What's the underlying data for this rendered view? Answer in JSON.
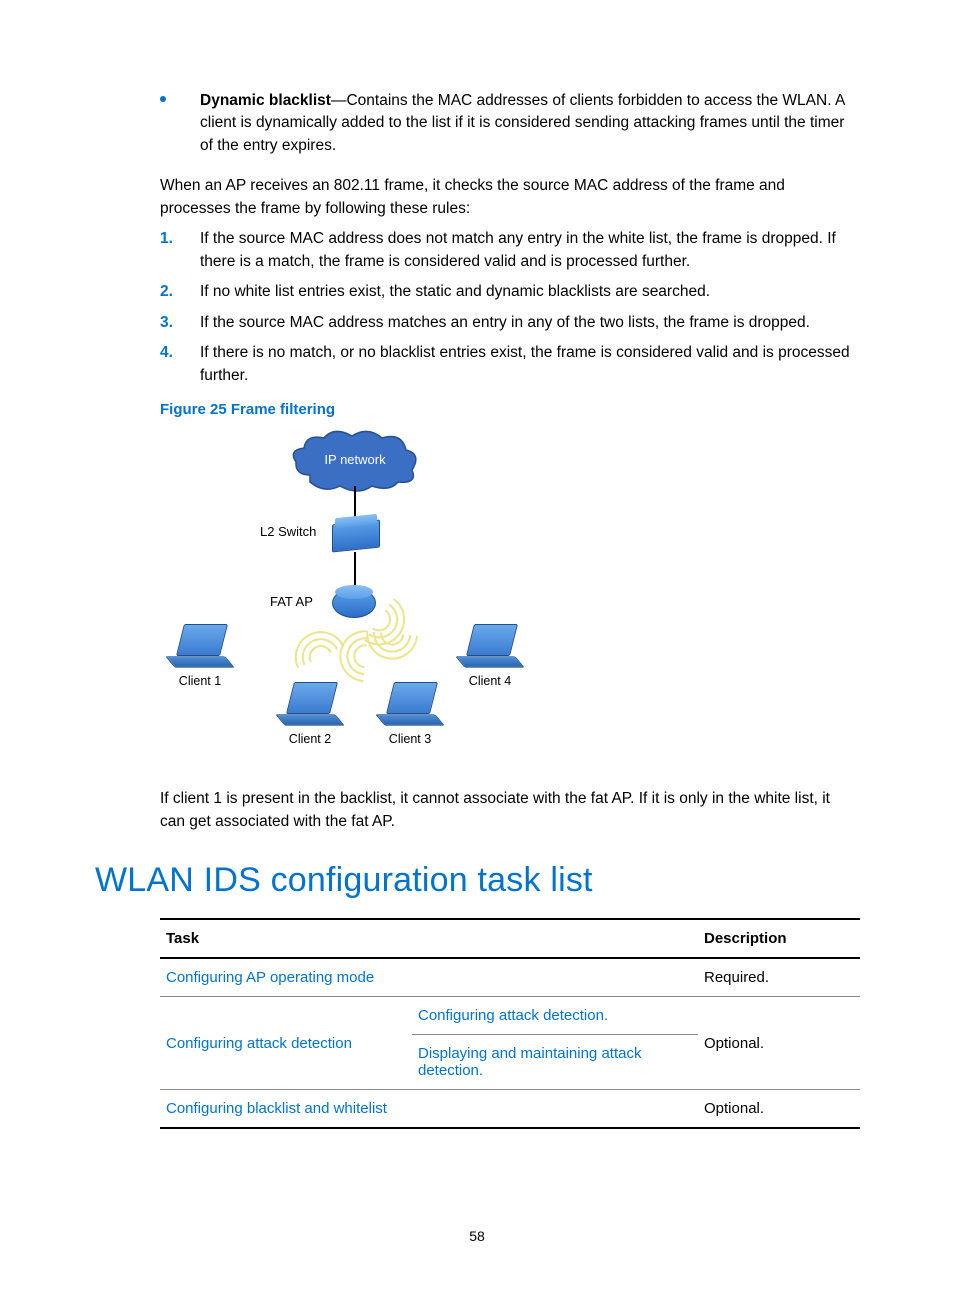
{
  "bullet": {
    "lead": "Dynamic blacklist",
    "text": "—Contains the MAC addresses of clients forbidden to access the WLAN. A client is dynamically added to the list if it is considered sending attacking frames until the timer of the entry expires."
  },
  "intro": "When an AP receives an 802.11 frame, it checks the source MAC address of the frame and processes the frame by following these rules:",
  "rules": [
    "If the source MAC address does not match any entry in the white list, the frame is dropped. If there is a match, the frame is considered valid and is processed further.",
    "If no white list entries exist, the static and dynamic blacklists are searched.",
    "If the source MAC address matches an entry in any of the two lists, the frame is dropped.",
    "If there is no match, or no blacklist entries exist, the frame is considered valid and is processed further."
  ],
  "figure": {
    "caption": "Figure 25 Frame filtering",
    "ip_network": "IP network",
    "l2_switch": "L2 Switch",
    "fat_ap": "FAT AP",
    "clients": [
      "Client 1",
      "Client 2",
      "Client 3",
      "Client 4"
    ]
  },
  "after_figure": "If client 1 is present in the backlist, it cannot associate with the fat AP. If it is only in the white list, it can get associated with the fat AP.",
  "heading": "WLAN IDS configuration task list",
  "table": {
    "headers": {
      "task": "Task",
      "desc": "Description"
    },
    "rows": [
      {
        "task": "Configuring AP operating mode",
        "sub": "",
        "desc": "Required."
      },
      {
        "task": "Configuring attack detection",
        "sub1": "Configuring attack detection.",
        "sub2": "Displaying and maintaining attack detection.",
        "desc": "Optional."
      },
      {
        "task": "Configuring blacklist and whitelist",
        "sub": "",
        "desc": "Optional."
      }
    ]
  },
  "page_number": "58"
}
